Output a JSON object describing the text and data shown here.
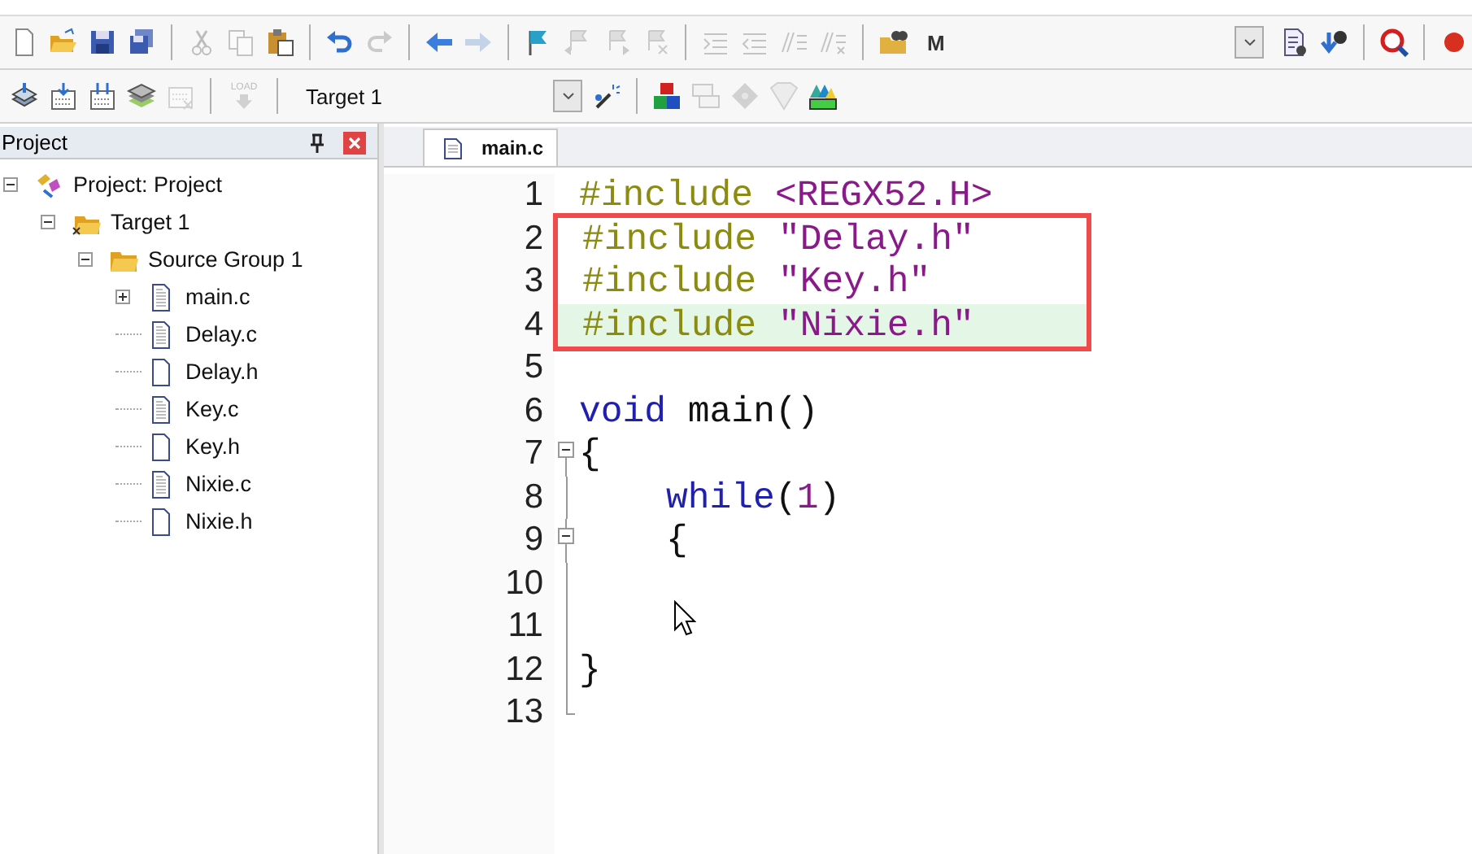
{
  "toolbars": [
    {
      "left_items": [
        {
          "kind": "new",
          "disabled": false
        },
        {
          "kind": "open",
          "disabled": false
        },
        {
          "kind": "save",
          "disabled": false
        },
        {
          "kind": "saveall",
          "disabled": false
        },
        {
          "kind": "separator"
        },
        {
          "kind": "cut",
          "disabled": true
        },
        {
          "kind": "copy",
          "disabled": true
        },
        {
          "kind": "paste",
          "disabled": false
        },
        {
          "kind": "separator"
        },
        {
          "kind": "undo",
          "disabled": false
        },
        {
          "kind": "redo",
          "disabled": true
        },
        {
          "kind": "separator"
        },
        {
          "kind": "back",
          "disabled": false
        },
        {
          "kind": "forward",
          "disabled": true
        },
        {
          "kind": "separator"
        },
        {
          "kind": "flag",
          "disabled": false
        },
        {
          "kind": "flagprev",
          "disabled": true
        },
        {
          "kind": "flagnext",
          "disabled": true
        },
        {
          "kind": "flagclear",
          "disabled": true
        },
        {
          "kind": "separator"
        },
        {
          "kind": "indent",
          "disabled": true
        },
        {
          "kind": "outdent",
          "disabled": true
        },
        {
          "kind": "comment",
          "disabled": true
        },
        {
          "kind": "uncomment",
          "disabled": true
        },
        {
          "kind": "separator"
        },
        {
          "kind": "findfiles",
          "disabled": false
        },
        {
          "kind": "text",
          "label": "M",
          "disabled": false
        }
      ],
      "right_items": [
        {
          "kind": "dropdown",
          "disabled": false
        },
        {
          "kind": "docgear",
          "disabled": false
        },
        {
          "kind": "config",
          "disabled": false
        },
        {
          "kind": "separator"
        },
        {
          "kind": "debug",
          "disabled": false
        },
        {
          "kind": "separator"
        },
        {
          "kind": "breakpoint",
          "disabled": false
        }
      ]
    },
    {
      "left_items": [
        {
          "kind": "translate",
          "disabled": false
        },
        {
          "kind": "build",
          "disabled": false
        },
        {
          "kind": "rebuild",
          "disabled": false
        },
        {
          "kind": "batch",
          "disabled": false
        },
        {
          "kind": "stop",
          "disabled": true
        },
        {
          "kind": "separator"
        },
        {
          "kind": "load",
          "label": "LOAD",
          "disabled": true
        },
        {
          "kind": "separator"
        },
        {
          "kind": "select",
          "value": "Target 1",
          "disabled": false
        },
        {
          "kind": "wand",
          "disabled": false
        },
        {
          "kind": "separator"
        },
        {
          "kind": "components",
          "disabled": false
        },
        {
          "kind": "packs",
          "disabled": true
        },
        {
          "kind": "diamond",
          "disabled": true
        },
        {
          "kind": "funnel",
          "disabled": true
        },
        {
          "kind": "colorblocks",
          "disabled": false
        }
      ]
    }
  ],
  "project_panel": {
    "title": "Project",
    "tree": [
      {
        "label": "Project: Project",
        "kind": "project",
        "expanded": true,
        "children": [
          {
            "label": "Target 1",
            "kind": "target",
            "expanded": true,
            "children": [
              {
                "label": "Source Group 1",
                "kind": "group",
                "expanded": true,
                "children": [
                  {
                    "label": "main.c",
                    "kind": "source",
                    "expanded": false
                  },
                  {
                    "label": "Delay.c",
                    "kind": "source"
                  },
                  {
                    "label": "Delay.h",
                    "kind": "header"
                  },
                  {
                    "label": "Key.c",
                    "kind": "source"
                  },
                  {
                    "label": "Key.h",
                    "kind": "header"
                  },
                  {
                    "label": "Nixie.c",
                    "kind": "source"
                  },
                  {
                    "label": "Nixie.h",
                    "kind": "header"
                  }
                ]
              }
            ]
          }
        ]
      }
    ]
  },
  "editor": {
    "tabs": [
      {
        "label": "main.c",
        "selected": true
      }
    ],
    "lines": [
      {
        "number": "1",
        "fold_start": false,
        "current": false,
        "boxed": false,
        "tokens": [
          {
            "kind": "preproc",
            "text": "#include"
          },
          {
            "kind": "string",
            "text": "<REGX52.H>"
          }
        ]
      },
      {
        "number": "2",
        "fold_start": false,
        "current": false,
        "boxed": true,
        "tokens": [
          {
            "kind": "preproc",
            "text": "#include"
          },
          {
            "kind": "string",
            "text": "\"Delay.h\""
          }
        ]
      },
      {
        "number": "3",
        "fold_start": false,
        "current": false,
        "boxed": true,
        "tokens": [
          {
            "kind": "preproc",
            "text": "#include"
          },
          {
            "kind": "string",
            "text": "\"Key.h\""
          }
        ]
      },
      {
        "number": "4",
        "fold_start": false,
        "current": true,
        "boxed": true,
        "tokens": [
          {
            "kind": "preproc",
            "text": "#include"
          },
          {
            "kind": "string",
            "text": "\"Nixie.h\""
          }
        ]
      },
      {
        "number": "5",
        "fold_start": false,
        "current": false,
        "boxed": false
      },
      {
        "number": "6",
        "fold_start": false,
        "current": false,
        "boxed": false,
        "tokens": [
          {
            "kind": "keyword",
            "text": "void"
          },
          {
            "kind": "plain",
            "text": "main()"
          }
        ]
      },
      {
        "number": "7",
        "fold_start": true,
        "current": false,
        "boxed": false,
        "tokens": [
          {
            "kind": "plain",
            "text": "{"
          }
        ]
      },
      {
        "number": "8",
        "fold_start": false,
        "current": false,
        "boxed": false,
        "tokens": [
          {
            "kind": "keyword",
            "text": "    while"
          },
          {
            "kind": "plain",
            "text": "("
          },
          {
            "kind": "number",
            "text": "1"
          },
          {
            "kind": "plain",
            "text": ")"
          }
        ]
      },
      {
        "number": "9",
        "fold_start": true,
        "current": false,
        "boxed": false,
        "tokens": [
          {
            "kind": "plain",
            "text": "    {"
          }
        ]
      },
      {
        "number": "10",
        "fold_start": false,
        "current": false,
        "boxed": false
      },
      {
        "number": "11",
        "fold_start": false,
        "current": false,
        "boxed": false
      },
      {
        "number": "12",
        "fold_start": false,
        "current": false,
        "boxed": false,
        "tokens": [
          {
            "kind": "plain",
            "text": "}"
          }
        ]
      },
      {
        "number": "13",
        "fold_start": false,
        "current": false,
        "boxed": false
      }
    ]
  }
}
